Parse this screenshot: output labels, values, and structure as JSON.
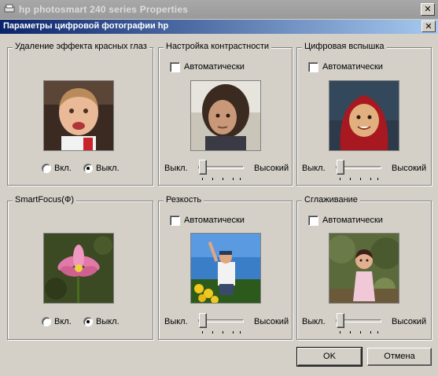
{
  "window": {
    "outer_title": "hp photosmart 240 series Properties",
    "dialog_title": "Параметры цифровой фотографии hp",
    "close_glyph": "✕"
  },
  "groups": {
    "red_eye": {
      "title": "Удаление эффекта красных глаз",
      "radio_on_label": "Вкл.",
      "radio_off_label": "Выкл.",
      "selected": "off",
      "photo_icon": "toddler-photo"
    },
    "contrast": {
      "title": "Настройка контрастности",
      "auto_label": "Автоматически",
      "auto_checked": false,
      "slider_min_label": "Выкл.",
      "slider_max_label": "Высокий",
      "slider_level": 0,
      "photo_icon": "girl-portrait-photo"
    },
    "flash": {
      "title": "Цифровая вспышка",
      "auto_label": "Автоматически",
      "auto_checked": false,
      "slider_min_label": "Выкл.",
      "slider_max_label": "Высокий",
      "slider_level": 0,
      "photo_icon": "child-red-hood-photo"
    },
    "smartfocus": {
      "title": "SmartFocus(Ф)",
      "radio_on_label": "Вкл.",
      "radio_off_label": "Выкл.",
      "selected": "off",
      "photo_icon": "pink-lotus-photo"
    },
    "sharpness": {
      "title": "Резкость",
      "auto_label": "Автоматически",
      "auto_checked": false,
      "slider_min_label": "Выкл.",
      "slider_max_label": "Высокий",
      "slider_level": 0,
      "photo_icon": "boy-flowers-sky-photo"
    },
    "smoothing": {
      "title": "Сглаживание",
      "auto_label": "Автоматически",
      "auto_checked": false,
      "slider_min_label": "Выкл.",
      "slider_max_label": "Высокий",
      "slider_level": 0,
      "photo_icon": "girl-garden-photo"
    }
  },
  "buttons": {
    "ok": "OK",
    "cancel": "Отмена"
  },
  "colors": {
    "dialog_title_start": "#0a246a",
    "dialog_title_end": "#a6caf0",
    "face": "#d4d0c8"
  }
}
